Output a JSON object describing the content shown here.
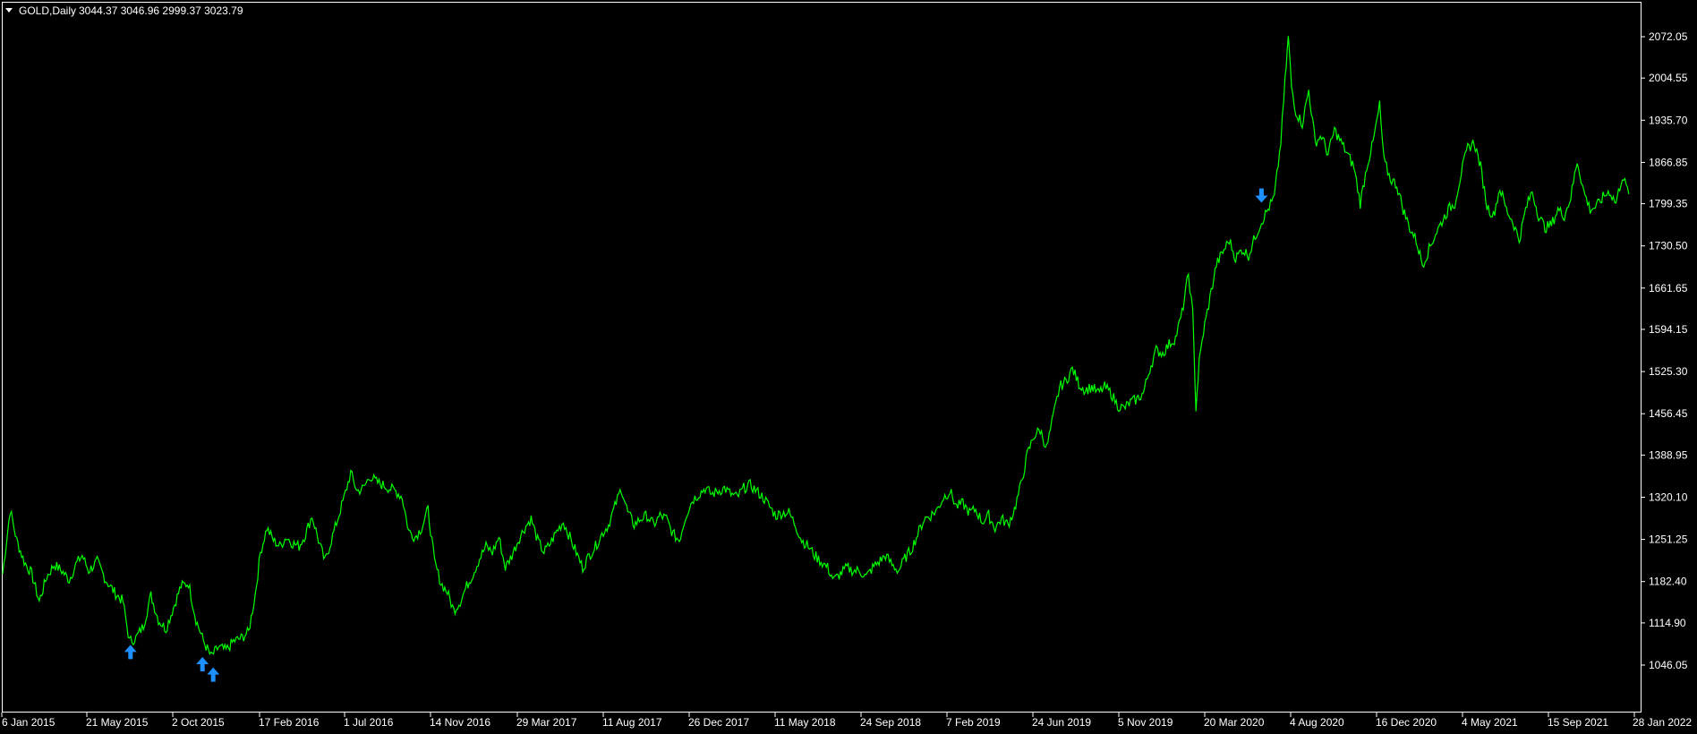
{
  "header": {
    "symbol": "GOLD,Daily",
    "ohlc": "3044.37 3046.96 2999.37 3023.79",
    "menu_icon": "triangle-down-icon"
  },
  "colors": {
    "background": "#000000",
    "line": "#00ff00",
    "frame": "#ffffff",
    "signal": "#1e90ff"
  },
  "chart_data": {
    "type": "line",
    "series": [
      {
        "values": [
          [
            0,
            1195
          ],
          [
            7,
            1300
          ],
          [
            13,
            1250
          ],
          [
            20,
            1215
          ],
          [
            27,
            1195
          ],
          [
            34,
            1150
          ],
          [
            41,
            1190
          ],
          [
            48,
            1210
          ],
          [
            55,
            1200
          ],
          [
            62,
            1185
          ],
          [
            68,
            1210
          ],
          [
            74,
            1225
          ],
          [
            80,
            1200
          ],
          [
            88,
            1215
          ],
          [
            96,
            1185
          ],
          [
            104,
            1165
          ],
          [
            112,
            1150
          ],
          [
            118,
            1085
          ],
          [
            124,
            1090
          ],
          [
            131,
            1110
          ],
          [
            138,
            1160
          ],
          [
            145,
            1120
          ],
          [
            152,
            1105
          ],
          [
            159,
            1140
          ],
          [
            166,
            1175
          ],
          [
            173,
            1180
          ],
          [
            180,
            1120
          ],
          [
            187,
            1085
          ],
          [
            194,
            1060
          ],
          [
            201,
            1075
          ],
          [
            208,
            1070
          ],
          [
            215,
            1085
          ],
          [
            222,
            1090
          ],
          [
            229,
            1100
          ],
          [
            235,
            1160
          ],
          [
            240,
            1230
          ],
          [
            246,
            1270
          ],
          [
            252,
            1250
          ],
          [
            258,
            1240
          ],
          [
            264,
            1255
          ],
          [
            270,
            1245
          ],
          [
            276,
            1240
          ],
          [
            282,
            1260
          ],
          [
            288,
            1290
          ],
          [
            294,
            1250
          ],
          [
            300,
            1215
          ],
          [
            306,
            1250
          ],
          [
            312,
            1285
          ],
          [
            318,
            1320
          ],
          [
            324,
            1360
          ],
          [
            330,
            1330
          ],
          [
            336,
            1335
          ],
          [
            342,
            1355
          ],
          [
            348,
            1345
          ],
          [
            354,
            1340
          ],
          [
            360,
            1335
          ],
          [
            366,
            1330
          ],
          [
            372,
            1320
          ],
          [
            378,
            1265
          ],
          [
            384,
            1255
          ],
          [
            390,
            1270
          ],
          [
            396,
            1300
          ],
          [
            402,
            1215
          ],
          [
            408,
            1180
          ],
          [
            414,
            1165
          ],
          [
            420,
            1135
          ],
          [
            426,
            1150
          ],
          [
            432,
            1175
          ],
          [
            438,
            1195
          ],
          [
            444,
            1220
          ],
          [
            450,
            1240
          ],
          [
            456,
            1230
          ],
          [
            462,
            1255
          ],
          [
            468,
            1205
          ],
          [
            474,
            1225
          ],
          [
            480,
            1250
          ],
          [
            486,
            1270
          ],
          [
            492,
            1285
          ],
          [
            498,
            1250
          ],
          [
            504,
            1230
          ],
          [
            510,
            1245
          ],
          [
            516,
            1265
          ],
          [
            522,
            1280
          ],
          [
            528,
            1255
          ],
          [
            534,
            1230
          ],
          [
            540,
            1205
          ],
          [
            546,
            1225
          ],
          [
            552,
            1240
          ],
          [
            558,
            1260
          ],
          [
            564,
            1275
          ],
          [
            570,
            1305
          ],
          [
            576,
            1335
          ],
          [
            582,
            1295
          ],
          [
            588,
            1275
          ],
          [
            594,
            1285
          ],
          [
            600,
            1290
          ],
          [
            606,
            1275
          ],
          [
            612,
            1290
          ],
          [
            618,
            1285
          ],
          [
            624,
            1260
          ],
          [
            630,
            1250
          ],
          [
            636,
            1290
          ],
          [
            642,
            1315
          ],
          [
            648,
            1325
          ],
          [
            654,
            1335
          ],
          [
            660,
            1325
          ],
          [
            666,
            1330
          ],
          [
            672,
            1335
          ],
          [
            678,
            1325
          ],
          [
            684,
            1320
          ],
          [
            690,
            1335
          ],
          [
            696,
            1340
          ],
          [
            702,
            1330
          ],
          [
            708,
            1320
          ],
          [
            714,
            1305
          ],
          [
            720,
            1290
          ],
          [
            726,
            1295
          ],
          [
            732,
            1295
          ],
          [
            738,
            1275
          ],
          [
            744,
            1250
          ],
          [
            750,
            1240
          ],
          [
            756,
            1225
          ],
          [
            762,
            1215
          ],
          [
            768,
            1205
          ],
          [
            774,
            1185
          ],
          [
            780,
            1195
          ],
          [
            786,
            1205
          ],
          [
            792,
            1200
          ],
          [
            798,
            1200
          ],
          [
            804,
            1190
          ],
          [
            810,
            1205
          ],
          [
            816,
            1215
          ],
          [
            822,
            1225
          ],
          [
            828,
            1210
          ],
          [
            834,
            1200
          ],
          [
            840,
            1220
          ],
          [
            846,
            1235
          ],
          [
            852,
            1260
          ],
          [
            858,
            1285
          ],
          [
            864,
            1290
          ],
          [
            870,
            1300
          ],
          [
            876,
            1320
          ],
          [
            882,
            1330
          ],
          [
            888,
            1305
          ],
          [
            894,
            1310
          ],
          [
            900,
            1295
          ],
          [
            906,
            1300
          ],
          [
            912,
            1280
          ],
          [
            918,
            1290
          ],
          [
            924,
            1270
          ],
          [
            930,
            1285
          ],
          [
            936,
            1275
          ],
          [
            942,
            1300
          ],
          [
            948,
            1340
          ],
          [
            954,
            1390
          ],
          [
            960,
            1420
          ],
          [
            966,
            1430
          ],
          [
            972,
            1400
          ],
          [
            978,
            1450
          ],
          [
            984,
            1500
          ],
          [
            990,
            1510
          ],
          [
            996,
            1530
          ],
          [
            1002,
            1505
          ],
          [
            1008,
            1495
          ],
          [
            1014,
            1500
          ],
          [
            1020,
            1490
          ],
          [
            1026,
            1500
          ],
          [
            1032,
            1490
          ],
          [
            1038,
            1470
          ],
          [
            1044,
            1465
          ],
          [
            1050,
            1475
          ],
          [
            1056,
            1480
          ],
          [
            1062,
            1490
          ],
          [
            1068,
            1530
          ],
          [
            1074,
            1560
          ],
          [
            1080,
            1555
          ],
          [
            1086,
            1570
          ],
          [
            1092,
            1580
          ],
          [
            1098,
            1620
          ],
          [
            1104,
            1685
          ],
          [
            1108,
            1620
          ],
          [
            1111,
            1465
          ],
          [
            1114,
            1540
          ],
          [
            1118,
            1590
          ],
          [
            1124,
            1645
          ],
          [
            1130,
            1700
          ],
          [
            1136,
            1720
          ],
          [
            1142,
            1740
          ],
          [
            1148,
            1710
          ],
          [
            1154,
            1725
          ],
          [
            1160,
            1715
          ],
          [
            1166,
            1745
          ],
          [
            1172,
            1770
          ],
          [
            1178,
            1790
          ],
          [
            1184,
            1810
          ],
          [
            1190,
            1900
          ],
          [
            1194,
            2000
          ],
          [
            1197,
            2072
          ],
          [
            1200,
            1990
          ],
          [
            1204,
            1950
          ],
          [
            1210,
            1930
          ],
          [
            1216,
            1985
          ],
          [
            1222,
            1900
          ],
          [
            1228,
            1910
          ],
          [
            1234,
            1880
          ],
          [
            1240,
            1920
          ],
          [
            1246,
            1900
          ],
          [
            1252,
            1880
          ],
          [
            1258,
            1860
          ],
          [
            1264,
            1800
          ],
          [
            1270,
            1860
          ],
          [
            1276,
            1900
          ],
          [
            1282,
            1960
          ],
          [
            1286,
            1870
          ],
          [
            1292,
            1840
          ],
          [
            1298,
            1830
          ],
          [
            1304,
            1790
          ],
          [
            1310,
            1760
          ],
          [
            1316,
            1740
          ],
          [
            1322,
            1700
          ],
          [
            1328,
            1725
          ],
          [
            1334,
            1750
          ],
          [
            1340,
            1770
          ],
          [
            1346,
            1790
          ],
          [
            1352,
            1800
          ],
          [
            1358,
            1850
          ],
          [
            1364,
            1890
          ],
          [
            1370,
            1900
          ],
          [
            1376,
            1860
          ],
          [
            1382,
            1795
          ],
          [
            1388,
            1780
          ],
          [
            1394,
            1825
          ],
          [
            1400,
            1790
          ],
          [
            1406,
            1770
          ],
          [
            1412,
            1740
          ],
          [
            1418,
            1790
          ],
          [
            1424,
            1820
          ],
          [
            1430,
            1780
          ],
          [
            1436,
            1760
          ],
          [
            1442,
            1765
          ],
          [
            1448,
            1790
          ],
          [
            1454,
            1780
          ],
          [
            1460,
            1810
          ],
          [
            1466,
            1870
          ],
          [
            1472,
            1820
          ],
          [
            1478,
            1790
          ],
          [
            1484,
            1795
          ],
          [
            1490,
            1810
          ],
          [
            1496,
            1820
          ],
          [
            1502,
            1800
          ],
          [
            1508,
            1845
          ],
          [
            1514,
            1815
          ]
        ]
      }
    ],
    "x_ticks": [
      "6 Jan 2015",
      "21 May 2015",
      "2 Oct 2015",
      "17 Feb 2016",
      "1 Jul 2016",
      "14 Nov 2016",
      "29 Mar 2017",
      "11 Aug 2017",
      "26 Dec 2017",
      "11 May 2018",
      "24 Sep 2018",
      "7 Feb 2019",
      "24 Jun 2019",
      "5 Nov 2019",
      "20 Mar 2020",
      "4 Aug 2020",
      "16 Dec 2020",
      "4 May 2021",
      "15 Sep 2021",
      "28 Jan 2022"
    ],
    "y_ticks": [
      "2072.05",
      "2004.55",
      "1935.70",
      "1866.85",
      "1799.35",
      "1730.50",
      "1661.65",
      "1594.15",
      "1525.30",
      "1456.45",
      "1388.95",
      "1320.10",
      "1251.25",
      "1182.40",
      "1114.90",
      "1046.05"
    ],
    "ylim": [
      1030,
      2092
    ],
    "grid": false,
    "signals": [
      {
        "direction": "up",
        "x": 119,
        "value": 1085
      },
      {
        "direction": "up",
        "x": 186,
        "value": 1065
      },
      {
        "direction": "up",
        "x": 196,
        "value": 1048
      },
      {
        "direction": "down",
        "x": 1172,
        "value": 1795
      }
    ]
  }
}
